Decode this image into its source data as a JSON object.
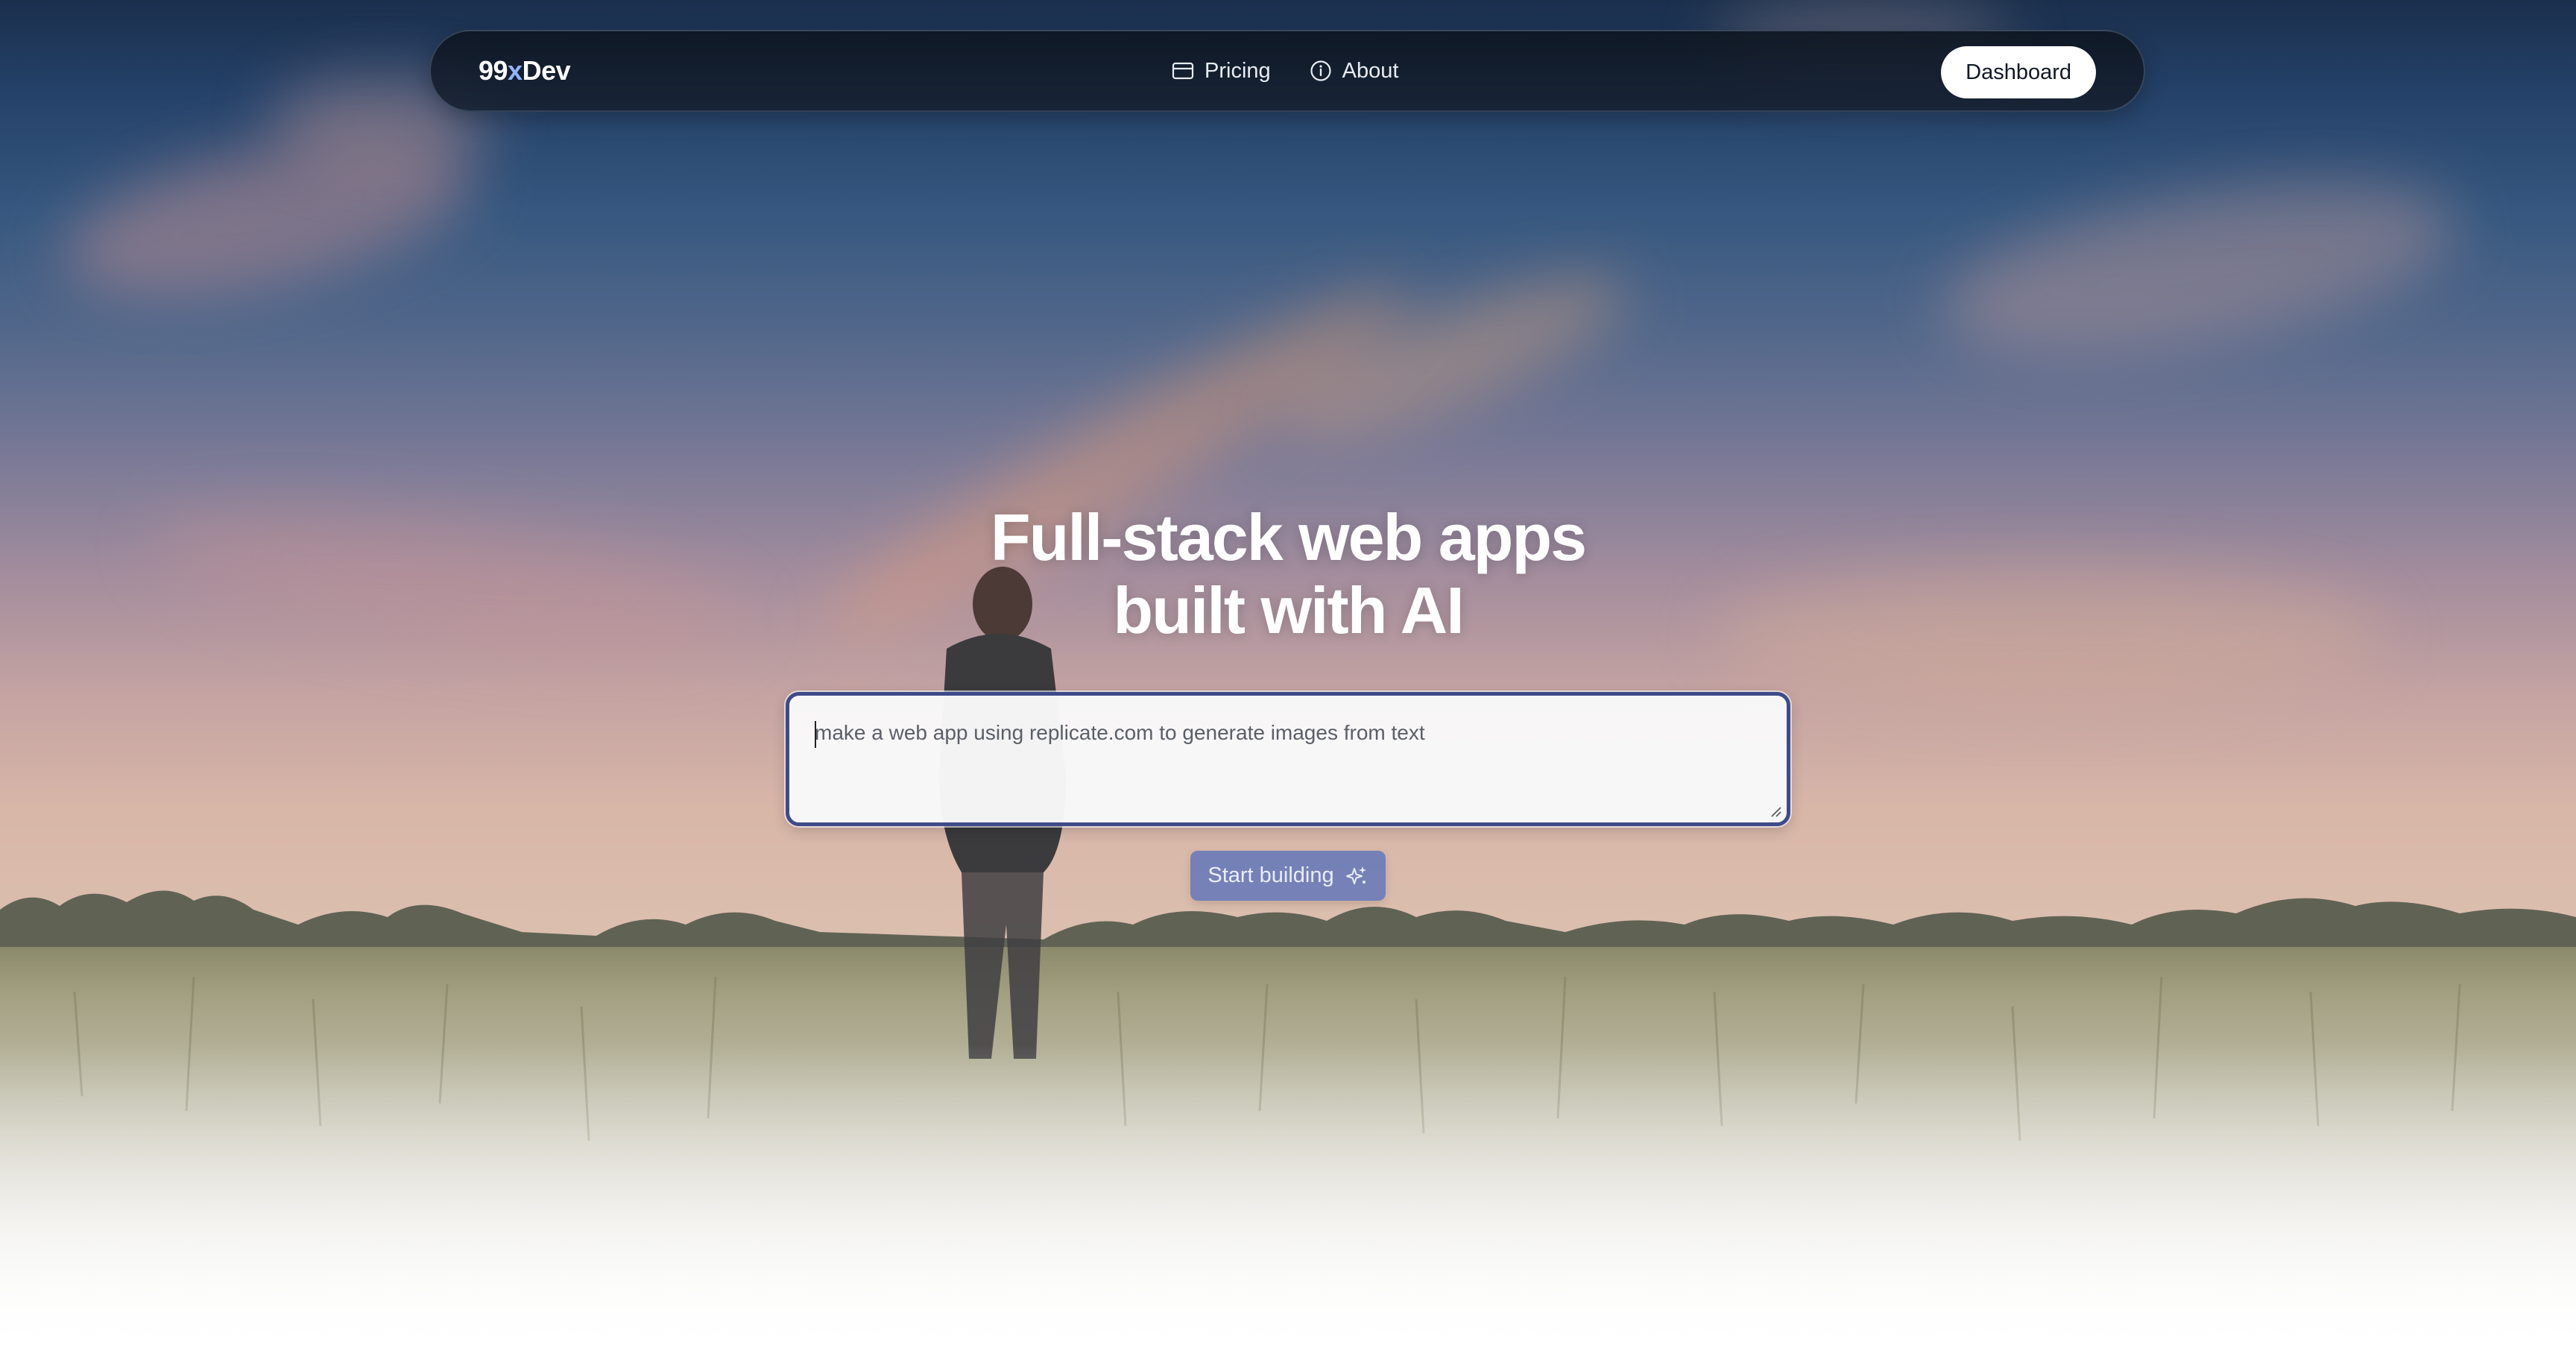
{
  "navbar": {
    "brand_prefix": "99",
    "brand_accent": "x",
    "brand_suffix": "Dev",
    "links": [
      {
        "label": "Pricing",
        "icon": "credit-card-icon"
      },
      {
        "label": "About",
        "icon": "info-circle-icon"
      }
    ],
    "dashboard_label": "Dashboard"
  },
  "hero": {
    "title_line1": "Full-stack web apps",
    "title_line2": "built with AI",
    "prompt_placeholder": "make a web app using replicate.com to generate images from text",
    "start_label": "Start building",
    "start_icon": "sparkles-icon"
  },
  "colors": {
    "accent": "#5e74ba",
    "brand_accent": "#8fb4ff",
    "input_border": "#3e4b8a",
    "navbar_bg": "#0e1622"
  }
}
